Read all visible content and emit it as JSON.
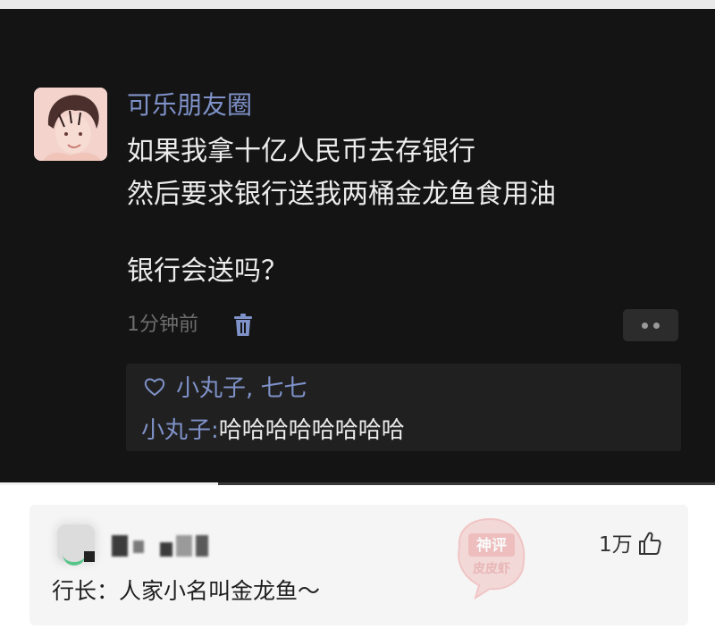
{
  "post": {
    "poster_name": "可乐朋友圈",
    "lines": [
      "如果我拿十亿人民币去存银行",
      "然后要求银行送我两桶金龙鱼食用油",
      "银行会送吗？"
    ],
    "time": "1分钟前",
    "likes": "小丸子, 七七",
    "comment_author": "小丸子:",
    "comment_text": "哈哈哈哈哈哈哈哈"
  },
  "reply": {
    "text": "行长：人家小名叫金龙鱼～",
    "like_count": "1万"
  },
  "watermark": {
    "line1": "神评",
    "line2": "皮皮虾"
  },
  "colors": {
    "accent": "#7f92c9",
    "dark_bg": "#141414",
    "card_bg": "#f5f5f5"
  },
  "icons": [
    "trash-icon",
    "heart-icon",
    "more-icon",
    "thumbs-up-icon"
  ]
}
